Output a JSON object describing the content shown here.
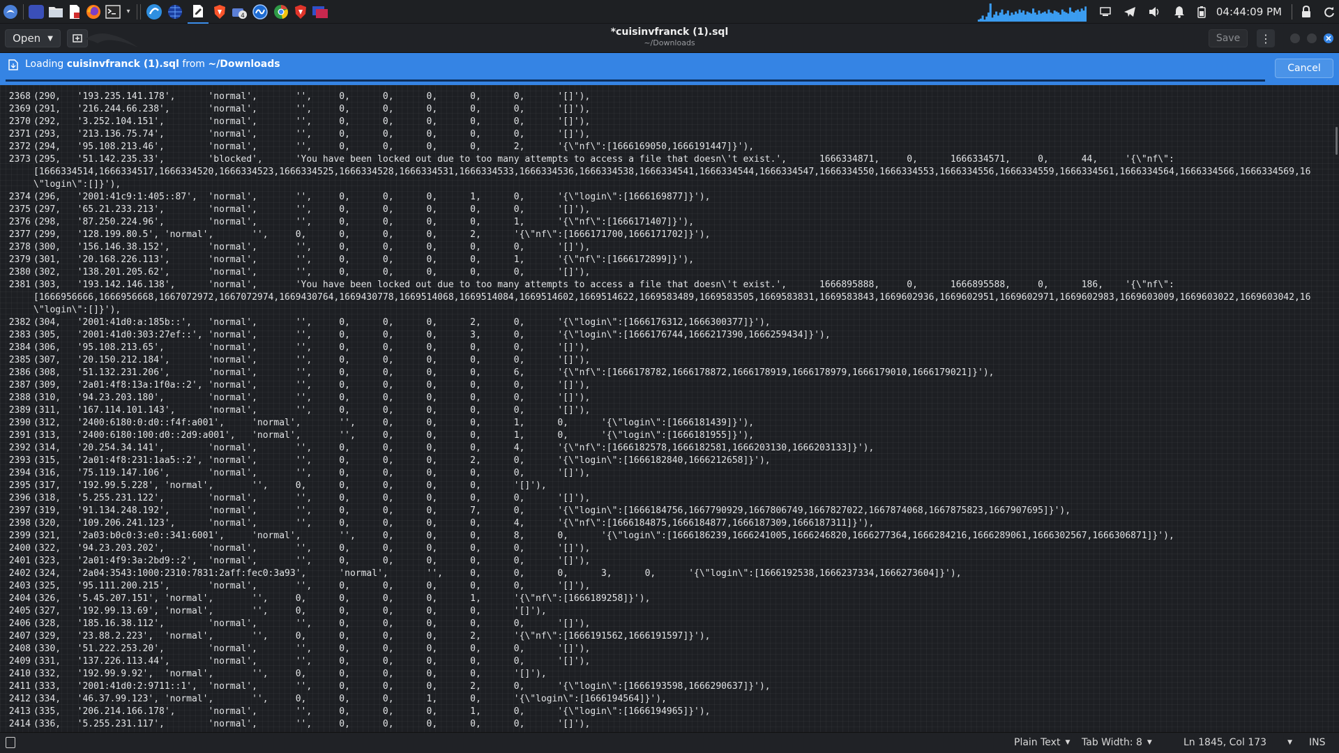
{
  "panel": {
    "clock": "04:44:09 PM",
    "graph_levels": [
      2,
      3,
      6,
      2,
      5,
      9,
      18,
      4,
      7,
      10,
      6,
      9,
      12,
      7,
      8,
      11,
      6,
      9,
      7,
      10,
      8,
      12,
      9,
      11,
      7,
      10,
      9,
      8,
      13,
      9,
      7,
      11,
      8,
      9,
      10,
      8,
      12,
      9,
      8,
      11,
      10,
      9,
      7,
      12,
      10,
      9,
      8,
      14,
      10,
      9,
      11,
      12,
      10,
      13,
      11,
      15
    ]
  },
  "header": {
    "open_label": "Open",
    "title": "*cuisinvfranck (1).sql",
    "subtitle": "~/Downloads",
    "save_label": "Save"
  },
  "infobar": {
    "prefix": "Loading ",
    "filename": "cuisinvfranck (1).sql",
    "middle": " from ",
    "location": "~/Downloads",
    "cancel_label": "Cancel",
    "progress": 1.0
  },
  "editor": {
    "lines": [
      {
        "num": "2368",
        "text": "(290,\t'193.235.141.178',\t'normal',\t'',\t0,\t0,\t0,\t0,\t0,\t'[]'),"
      },
      {
        "num": "2369",
        "text": "(291,\t'216.244.66.238',\t'normal',\t'',\t0,\t0,\t0,\t0,\t0,\t'[]'),"
      },
      {
        "num": "2370",
        "text": "(292,\t'3.252.104.151',\t'normal',\t'',\t0,\t0,\t0,\t0,\t0,\t'[]'),"
      },
      {
        "num": "2371",
        "text": "(293,\t'213.136.75.74',\t'normal',\t'',\t0,\t0,\t0,\t0,\t0,\t'[]'),"
      },
      {
        "num": "2372",
        "text": "(294,\t'95.108.213.46',\t'normal',\t'',\t0,\t0,\t0,\t0,\t2,\t'{\\\"nf\\\":[1666169050,1666191447]}'),"
      },
      {
        "num": "2373",
        "text": "(295,\t'51.142.235.33',\t'blocked',\t'You have been locked out due to too many attempts to access a file that doesn\\'t exist.',\t1666334871,\t0,\t1666334571,\t0,\t44,\t'{\\\"nf\\\":"
      },
      {
        "num": "",
        "text": "[1666334514,1666334517,1666334520,1666334523,1666334525,1666334528,1666334531,1666334533,1666334536,1666334538,1666334541,1666334544,1666334547,1666334550,1666334553,1666334556,1666334559,1666334561,1666334564,1666334566,1666334569,16"
      },
      {
        "num": "",
        "text": "\\\"login\\\":[]}'),"
      },
      {
        "num": "2374",
        "text": "(296,\t'2001:41c9:1:405::87',\t'normal',\t'',\t0,\t0,\t0,\t1,\t0,\t'{\\\"login\\\":[1666169877]}'),"
      },
      {
        "num": "2375",
        "text": "(297,\t'65.21.233.213',\t'normal',\t'',\t0,\t0,\t0,\t0,\t0,\t'[]'),"
      },
      {
        "num": "2376",
        "text": "(298,\t'87.250.224.96',\t'normal',\t'',\t0,\t0,\t0,\t0,\t1,\t'{\\\"nf\\\":[1666171407]}'),"
      },
      {
        "num": "2377",
        "text": "(299,\t'128.199.80.5',\t'normal',\t'',\t0,\t0,\t0,\t0,\t2,\t'{\\\"nf\\\":[1666171700,1666171702]}'),"
      },
      {
        "num": "2378",
        "text": "(300,\t'156.146.38.152',\t'normal',\t'',\t0,\t0,\t0,\t0,\t0,\t'[]'),"
      },
      {
        "num": "2379",
        "text": "(301,\t'20.168.226.113',\t'normal',\t'',\t0,\t0,\t0,\t0,\t1,\t'{\\\"nf\\\":[1666172899]}'),"
      },
      {
        "num": "2380",
        "text": "(302,\t'138.201.205.62',\t'normal',\t'',\t0,\t0,\t0,\t0,\t0,\t'[]'),"
      },
      {
        "num": "2381",
        "text": "(303,\t'193.142.146.138',\t'normal',\t'You have been locked out due to too many attempts to access a file that doesn\\'t exist.',\t1666895888,\t0,\t1666895588,\t0,\t186,\t'{\\\"nf\\\":"
      },
      {
        "num": "",
        "text": "[1666956666,1666956668,1667072972,1667072974,1669430764,1669430778,1669514068,1669514084,1669514602,1669514622,1669583489,1669583505,1669583831,1669583843,1669602936,1669602951,1669602971,1669602983,1669603009,1669603022,1669603042,16"
      },
      {
        "num": "",
        "text": "\\\"login\\\":[]}'),"
      },
      {
        "num": "2382",
        "text": "(304,\t'2001:41d0:a:185b::',\t'normal',\t'',\t0,\t0,\t0,\t2,\t0,\t'{\\\"login\\\":[1666176312,1666300377]}'),"
      },
      {
        "num": "2383",
        "text": "(305,\t'2001:41d0:303:27ef::',\t'normal',\t'',\t0,\t0,\t0,\t3,\t0,\t'{\\\"login\\\":[1666176744,1666217390,1666259434]}'),"
      },
      {
        "num": "2384",
        "text": "(306,\t'95.108.213.65',\t'normal',\t'',\t0,\t0,\t0,\t0,\t0,\t'[]'),"
      },
      {
        "num": "2385",
        "text": "(307,\t'20.150.212.184',\t'normal',\t'',\t0,\t0,\t0,\t0,\t0,\t'[]'),"
      },
      {
        "num": "2386",
        "text": "(308,\t'51.132.231.206',\t'normal',\t'',\t0,\t0,\t0,\t0,\t6,\t'{\\\"nf\\\":[1666178782,1666178872,1666178919,1666178979,1666179010,1666179021]}'),"
      },
      {
        "num": "2387",
        "text": "(309,\t'2a01:4f8:13a:1f0a::2',\t'normal',\t'',\t0,\t0,\t0,\t0,\t0,\t'[]'),"
      },
      {
        "num": "2388",
        "text": "(310,\t'94.23.203.180',\t'normal',\t'',\t0,\t0,\t0,\t0,\t0,\t'[]'),"
      },
      {
        "num": "2389",
        "text": "(311,\t'167.114.101.143',\t'normal',\t'',\t0,\t0,\t0,\t0,\t0,\t'[]'),"
      },
      {
        "num": "2390",
        "text": "(312,\t'2400:6180:0:d0::f4f:a001',\t'normal',\t'',\t0,\t0,\t0,\t1,\t0,\t'{\\\"login\\\":[1666181439]}'),"
      },
      {
        "num": "2391",
        "text": "(313,\t'2400:6180:100:d0::2d9:a001',\t'normal',\t'',\t0,\t0,\t0,\t1,\t0,\t'{\\\"login\\\":[1666181955]}'),"
      },
      {
        "num": "2392",
        "text": "(314,\t'20.254.34.141',\t'normal',\t'',\t0,\t0,\t0,\t0,\t4,\t'{\\\"nf\\\":[1666182578,1666182581,1666203130,1666203133]}'),"
      },
      {
        "num": "2393",
        "text": "(315,\t'2a01:4f8:231:1aa5::2',\t'normal',\t'',\t0,\t0,\t0,\t2,\t0,\t'{\\\"login\\\":[1666182840,1666212658]}'),"
      },
      {
        "num": "2394",
        "text": "(316,\t'75.119.147.106',\t'normal',\t'',\t0,\t0,\t0,\t0,\t0,\t'[]'),"
      },
      {
        "num": "2395",
        "text": "(317,\t'192.99.5.228',\t'normal',\t'',\t0,\t0,\t0,\t0,\t0,\t'[]'),"
      },
      {
        "num": "2396",
        "text": "(318,\t'5.255.231.122',\t'normal',\t'',\t0,\t0,\t0,\t0,\t0,\t'[]'),"
      },
      {
        "num": "2397",
        "text": "(319,\t'91.134.248.192',\t'normal',\t'',\t0,\t0,\t0,\t7,\t0,\t'{\\\"login\\\":[1666184756,1667790929,1667806749,1667827022,1667874068,1667875823,1667907695]}'),"
      },
      {
        "num": "2398",
        "text": "(320,\t'109.206.241.123',\t'normal',\t'',\t0,\t0,\t0,\t0,\t4,\t'{\\\"nf\\\":[1666184875,1666184877,1666187309,1666187311]}'),"
      },
      {
        "num": "2399",
        "text": "(321,\t'2a03:b0c0:3:e0::341:6001',\t'normal',\t'',\t0,\t0,\t0,\t8,\t0,\t'{\\\"login\\\":[1666186239,1666241005,1666246820,1666277364,1666284216,1666289061,1666302567,1666306871]}'),"
      },
      {
        "num": "2400",
        "text": "(322,\t'94.23.203.202',\t'normal',\t'',\t0,\t0,\t0,\t0,\t0,\t'[]'),"
      },
      {
        "num": "2401",
        "text": "(323,\t'2a01:4f9:3a:2bd9::2',\t'normal',\t'',\t0,\t0,\t0,\t0,\t0,\t'[]'),"
      },
      {
        "num": "2402",
        "text": "(324,\t'2a04:3543:1000:2310:7831:2aff:fec0:3a93',\t'normal',\t'',\t0,\t0,\t0,\t3,\t0,\t'{\\\"login\\\":[1666192538,1666237334,1666273604]}'),"
      },
      {
        "num": "2403",
        "text": "(325,\t'95.111.200.215',\t'normal',\t'',\t0,\t0,\t0,\t0,\t0,\t'[]'),"
      },
      {
        "num": "2404",
        "text": "(326,\t'5.45.207.151',\t'normal',\t'',\t0,\t0,\t0,\t0,\t1,\t'{\\\"nf\\\":[1666189258]}'),"
      },
      {
        "num": "2405",
        "text": "(327,\t'192.99.13.69',\t'normal',\t'',\t0,\t0,\t0,\t0,\t0,\t'[]'),"
      },
      {
        "num": "2406",
        "text": "(328,\t'185.16.38.112',\t'normal',\t'',\t0,\t0,\t0,\t0,\t0,\t'[]'),"
      },
      {
        "num": "2407",
        "text": "(329,\t'23.88.2.223',\t'normal',\t'',\t0,\t0,\t0,\t0,\t2,\t'{\\\"nf\\\":[1666191562,1666191597]}'),"
      },
      {
        "num": "2408",
        "text": "(330,\t'51.222.253.20',\t'normal',\t'',\t0,\t0,\t0,\t0,\t0,\t'[]'),"
      },
      {
        "num": "2409",
        "text": "(331,\t'137.226.113.44',\t'normal',\t'',\t0,\t0,\t0,\t0,\t0,\t'[]'),"
      },
      {
        "num": "2410",
        "text": "(332,\t'192.99.9.92',\t'normal',\t'',\t0,\t0,\t0,\t0,\t0,\t'[]'),"
      },
      {
        "num": "2411",
        "text": "(333,\t'2001:41d0:2:9711::1',\t'normal',\t'',\t0,\t0,\t0,\t2,\t0,\t'{\\\"login\\\":[1666193598,1666290637]}'),"
      },
      {
        "num": "2412",
        "text": "(334,\t'46.37.99.123',\t'normal',\t'',\t0,\t0,\t0,\t1,\t0,\t'{\\\"login\\\":[1666194564]}'),"
      },
      {
        "num": "2413",
        "text": "(335,\t'206.214.166.178',\t'normal',\t'',\t0,\t0,\t0,\t1,\t0,\t'{\\\"login\\\":[1666194965]}'),"
      },
      {
        "num": "2414",
        "text": "(336,\t'5.255.231.117',\t'normal',\t'',\t0,\t0,\t0,\t0,\t0,\t'[]'),"
      }
    ]
  },
  "statusbar": {
    "language": "Plain Text",
    "tab_width": "Tab Width: 8",
    "position": "Ln 1845, Col 173",
    "mode": "INS"
  },
  "colors": {
    "infobar_bg": "#3584e4",
    "editor_bg": "#1d1f23",
    "panel_bg": "#1e2023",
    "graph_color": "#3b9cf0"
  },
  "icons": {
    "panel_left": [
      "kali-menu-icon",
      "workspace-icon",
      "file-manager-icon",
      "text-editor-icon",
      "firefox-icon",
      "terminal-icon",
      "terminal-dropdown-icon",
      "app-circle-icon",
      "globe-icon",
      "document-editor-icon",
      "brave-icon",
      "cloud-app-icon",
      "wireshark-icon",
      "chrome-icon",
      "brave-alt-icon",
      "vm-app-icon"
    ],
    "panel_right": [
      "display-icon",
      "telegram-icon",
      "volume-icon",
      "notification-bell-icon",
      "battery-icon",
      "lock-icon",
      "refresh-icon"
    ]
  }
}
